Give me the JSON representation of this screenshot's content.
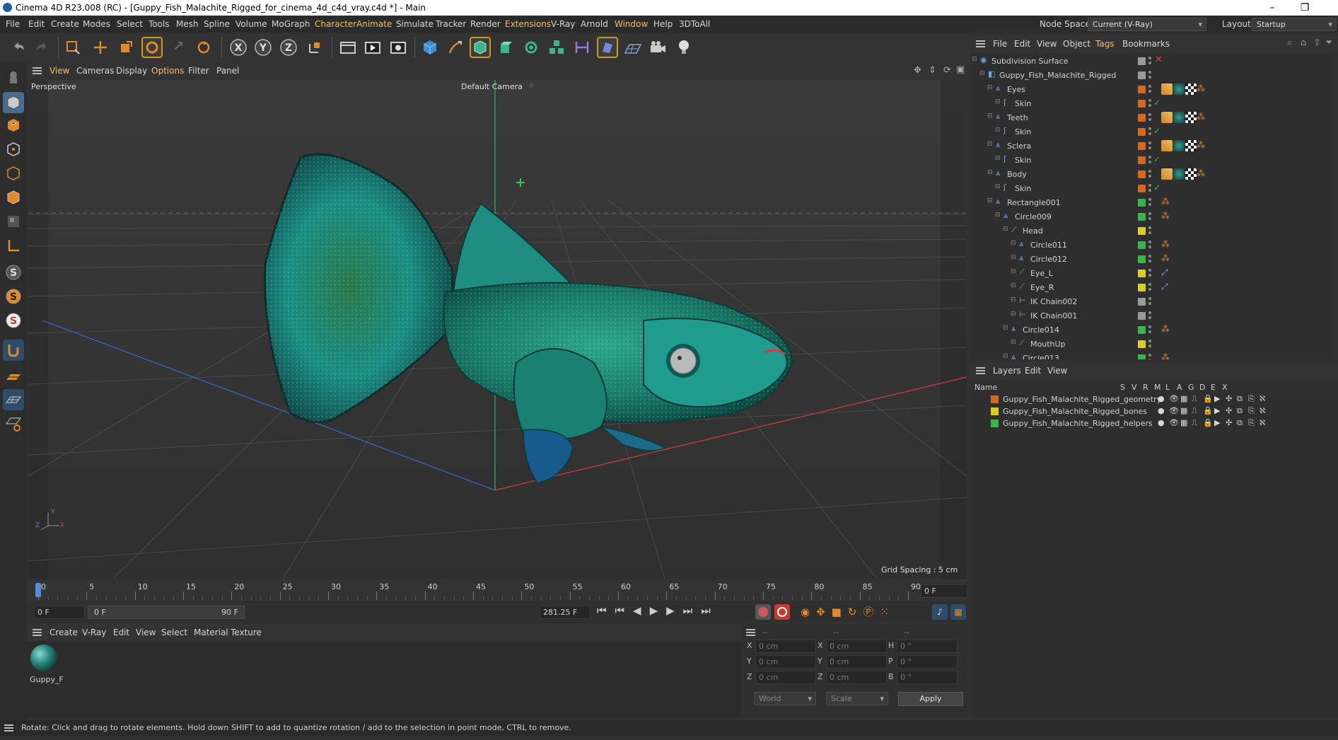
{
  "window": {
    "title": "Cinema 4D R23.008 (RC) - [Guppy_Fish_Malachite_Rigged_for_cinema_4d_c4d_vray.c4d *] - Main"
  },
  "menubar": {
    "items": [
      "File",
      "Edit",
      "Create",
      "Modes",
      "Select",
      "Tools",
      "Mesh",
      "Spline",
      "Volume",
      "MoGraph",
      "Character",
      "Animate",
      "Simulate",
      "Tracker",
      "Render",
      "Extensions",
      "V-Ray",
      "Arnold",
      "Window",
      "Help",
      "3DToAll"
    ],
    "node_space_label": "Node Space:",
    "node_space_value": "Current (V-Ray)",
    "layout_label": "Layout:",
    "layout_value": "Startup"
  },
  "viewport": {
    "menu": [
      "View",
      "Cameras",
      "Display",
      "Options",
      "Filter",
      "Panel"
    ],
    "projection": "Perspective",
    "camera": "Default Camera",
    "grid_spacing": "Grid Spacing : 5 cm",
    "axis_labels": {
      "x": "X",
      "y": "Y",
      "z": "Z"
    }
  },
  "timeline": {
    "ticks": [
      "0",
      "5",
      "10",
      "15",
      "20",
      "25",
      "30",
      "35",
      "40",
      "45",
      "50",
      "55",
      "60",
      "65",
      "70",
      "75",
      "80",
      "85",
      "90"
    ],
    "current_frame_right": "0 F",
    "start_field": "0 F",
    "range_start": "0 F",
    "range_end": "90 F",
    "fps_field": "281.25 F"
  },
  "material_manager": {
    "menu": [
      "Create",
      "V-Ray",
      "Edit",
      "View",
      "Select",
      "Material",
      "Texture"
    ],
    "materials": [
      {
        "name": "Guppy_F"
      }
    ]
  },
  "coordinates": {
    "header": [
      "--",
      "--",
      "--"
    ],
    "rows": [
      {
        "l1": "X",
        "v1": "0 cm",
        "l2": "X",
        "v2": "0 cm",
        "l3": "H",
        "v3": "0 °"
      },
      {
        "l1": "Y",
        "v1": "0 cm",
        "l2": "Y",
        "v2": "0 cm",
        "l3": "P",
        "v3": "0 °"
      },
      {
        "l1": "Z",
        "v1": "0 cm",
        "l2": "Z",
        "v2": "0 cm",
        "l3": "B",
        "v3": "0 °"
      }
    ],
    "mode": "World",
    "scale": "Scale",
    "apply": "Apply"
  },
  "status": "Rotate: Click and drag to rotate elements. Hold down SHIFT to add to quantize rotation / add to the selection in point mode, CTRL to remove.",
  "object_manager": {
    "menu": [
      "File",
      "Edit",
      "View",
      "Object",
      "Tags",
      "Bookmarks"
    ],
    "objects": [
      {
        "name": "Subdivision Surface",
        "indent": 0,
        "color": "#9a9a9a",
        "kind": "subd"
      },
      {
        "name": "Guppy_Fish_Malachite_Rigged",
        "indent": 1,
        "color": "#9a9a9a",
        "kind": "null"
      },
      {
        "name": "Eyes",
        "indent": 2,
        "color": "#d2691e",
        "kind": "bone",
        "tags": "mat"
      },
      {
        "name": "Skin",
        "indent": 3,
        "color": "#d2691e",
        "kind": "skin",
        "check": true
      },
      {
        "name": "Teeth",
        "indent": 2,
        "color": "#d2691e",
        "kind": "bone",
        "tags": "mat"
      },
      {
        "name": "Skin",
        "indent": 3,
        "color": "#d2691e",
        "kind": "skin",
        "check": true
      },
      {
        "name": "Sclera",
        "indent": 2,
        "color": "#d2691e",
        "kind": "bone",
        "tags": "mat"
      },
      {
        "name": "Skin",
        "indent": 3,
        "color": "#d2691e",
        "kind": "skin",
        "check": true
      },
      {
        "name": "Body",
        "indent": 2,
        "color": "#d2691e",
        "kind": "bone",
        "tags": "mat"
      },
      {
        "name": "Skin",
        "indent": 3,
        "color": "#d2691e",
        "kind": "skin",
        "check": true
      },
      {
        "name": "Rectangle001",
        "indent": 2,
        "color": "#39b54a",
        "kind": "bone",
        "tags": "ik"
      },
      {
        "name": "Circle009",
        "indent": 3,
        "color": "#39b54a",
        "kind": "bone",
        "tags": "ik"
      },
      {
        "name": "Head",
        "indent": 4,
        "color": "#d8d020",
        "kind": "joint"
      },
      {
        "name": "Circle011",
        "indent": 5,
        "color": "#39b54a",
        "kind": "bone",
        "tags": "ik"
      },
      {
        "name": "Circle012",
        "indent": 5,
        "color": "#39b54a",
        "kind": "bone",
        "tags": "ik"
      },
      {
        "name": "Eye_L",
        "indent": 5,
        "color": "#d8d020",
        "kind": "joint",
        "tags": "ikt"
      },
      {
        "name": "Eye_R",
        "indent": 5,
        "color": "#d8d020",
        "kind": "joint",
        "tags": "ikt"
      },
      {
        "name": "IK Chain002",
        "indent": 5,
        "color": "#9a9a9a",
        "kind": "ik"
      },
      {
        "name": "IK Chain001",
        "indent": 5,
        "color": "#9a9a9a",
        "kind": "ik"
      },
      {
        "name": "Circle014",
        "indent": 4,
        "color": "#39b54a",
        "kind": "bone",
        "tags": "ik"
      },
      {
        "name": "MouthUp",
        "indent": 5,
        "color": "#d8d020",
        "kind": "joint"
      },
      {
        "name": "Circle013",
        "indent": 4,
        "color": "#39b54a",
        "kind": "bone",
        "tags": "ik"
      }
    ]
  },
  "layer_manager": {
    "menu": [
      "Layers",
      "Edit",
      "View"
    ],
    "header": {
      "name": "Name",
      "flags": [
        "S",
        "V",
        "R",
        "M",
        "L",
        "A",
        "G",
        "D",
        "E",
        "X"
      ]
    },
    "layers": [
      {
        "name": "Guppy_Fish_Malachite_Rigged_geometry",
        "color": "#d2691e"
      },
      {
        "name": "Guppy_Fish_Malachite_Rigged_bones",
        "color": "#d8d020"
      },
      {
        "name": "Guppy_Fish_Malachite_Rigged_helpers",
        "color": "#39b54a"
      }
    ]
  }
}
